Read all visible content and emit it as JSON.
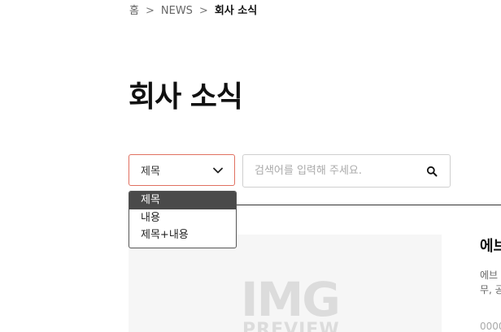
{
  "breadcrumb": {
    "home": "홈",
    "separator": ">",
    "section": "NEWS",
    "current": "회사 소식"
  },
  "page": {
    "title": "회사 소식"
  },
  "search": {
    "select_value": "제목",
    "placeholder": "검색어를 입력해 주세요.",
    "options": [
      "제목",
      "내용",
      "제목+내용"
    ],
    "selected_option": "제목"
  },
  "card": {
    "image_text": "IMG",
    "image_subtext": "PREVIEW",
    "title": "에브",
    "desc_line1": "에브",
    "desc_line2": "무, 공",
    "date": "0000"
  },
  "colors": {
    "select_border": "#e07060",
    "dropdown_selected_bg": "#4a4a4a"
  }
}
